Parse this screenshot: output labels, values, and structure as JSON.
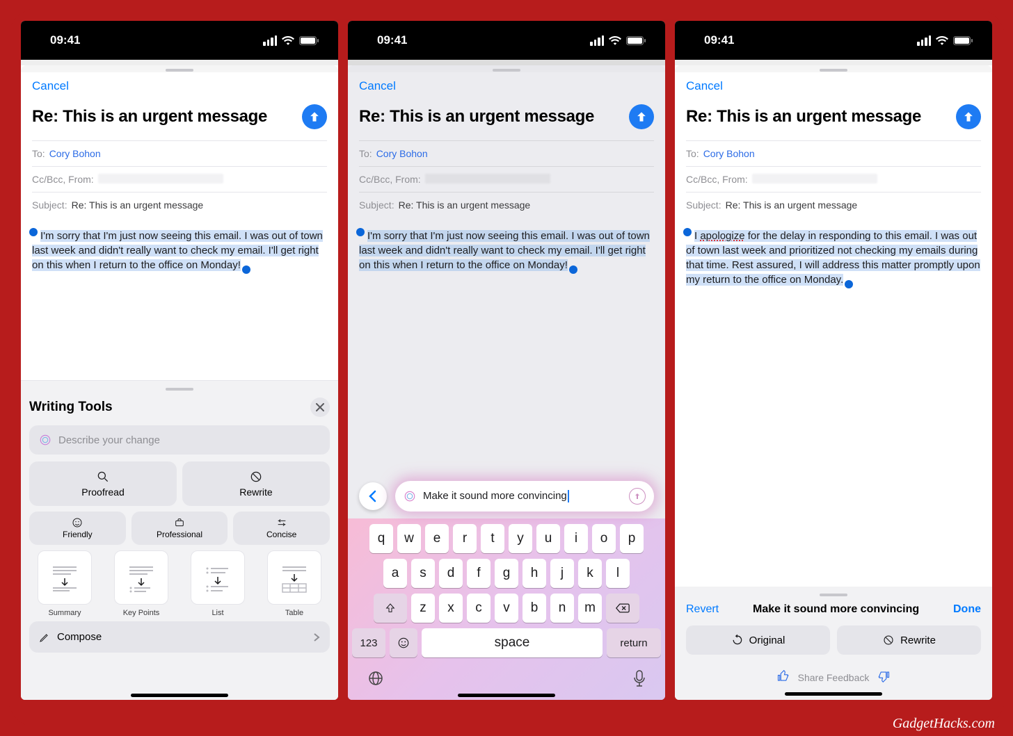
{
  "watermark": "GadgetHacks.com",
  "status": {
    "time": "09:41"
  },
  "compose": {
    "cancel": "Cancel",
    "title": "Re: This is an urgent message",
    "to_label": "To:",
    "to_value": "Cory Bohon",
    "cc_label": "Cc/Bcc, From:",
    "subject_label": "Subject:",
    "subject_value": "Re: This is an urgent message"
  },
  "body_original": "I'm sorry that I'm just now seeing this email. I was out of town last week and didn't really want to check my email. I'll get right on this when I return to the office on Monday!",
  "body_rewritten_pre": "I ",
  "body_rewritten_word": "apologize",
  "body_rewritten_post": " for the delay in responding to this email. I was out of town last week and prioritized not checking my emails during that time. Rest assured, I will address this matter promptly upon my return to the office on Monday.",
  "writing_tools": {
    "title": "Writing Tools",
    "describe_placeholder": "Describe your change",
    "proofread": "Proofread",
    "rewrite": "Rewrite",
    "friendly": "Friendly",
    "professional": "Professional",
    "concise": "Concise",
    "summary": "Summary",
    "keypoints": "Key Points",
    "list": "List",
    "table": "Table",
    "compose": "Compose"
  },
  "prompt_input": "Make it sound more convincing",
  "keyboard": {
    "row1": [
      "q",
      "w",
      "e",
      "r",
      "t",
      "y",
      "u",
      "i",
      "o",
      "p"
    ],
    "row2": [
      "a",
      "s",
      "d",
      "f",
      "g",
      "h",
      "j",
      "k",
      "l"
    ],
    "row3": [
      "z",
      "x",
      "c",
      "v",
      "b",
      "n",
      "m"
    ],
    "space": "space",
    "return": "return",
    "numbers": "123"
  },
  "review": {
    "revert": "Revert",
    "title": "Make it sound more convincing",
    "done": "Done",
    "original": "Original",
    "rewrite": "Rewrite",
    "feedback": "Share Feedback"
  }
}
